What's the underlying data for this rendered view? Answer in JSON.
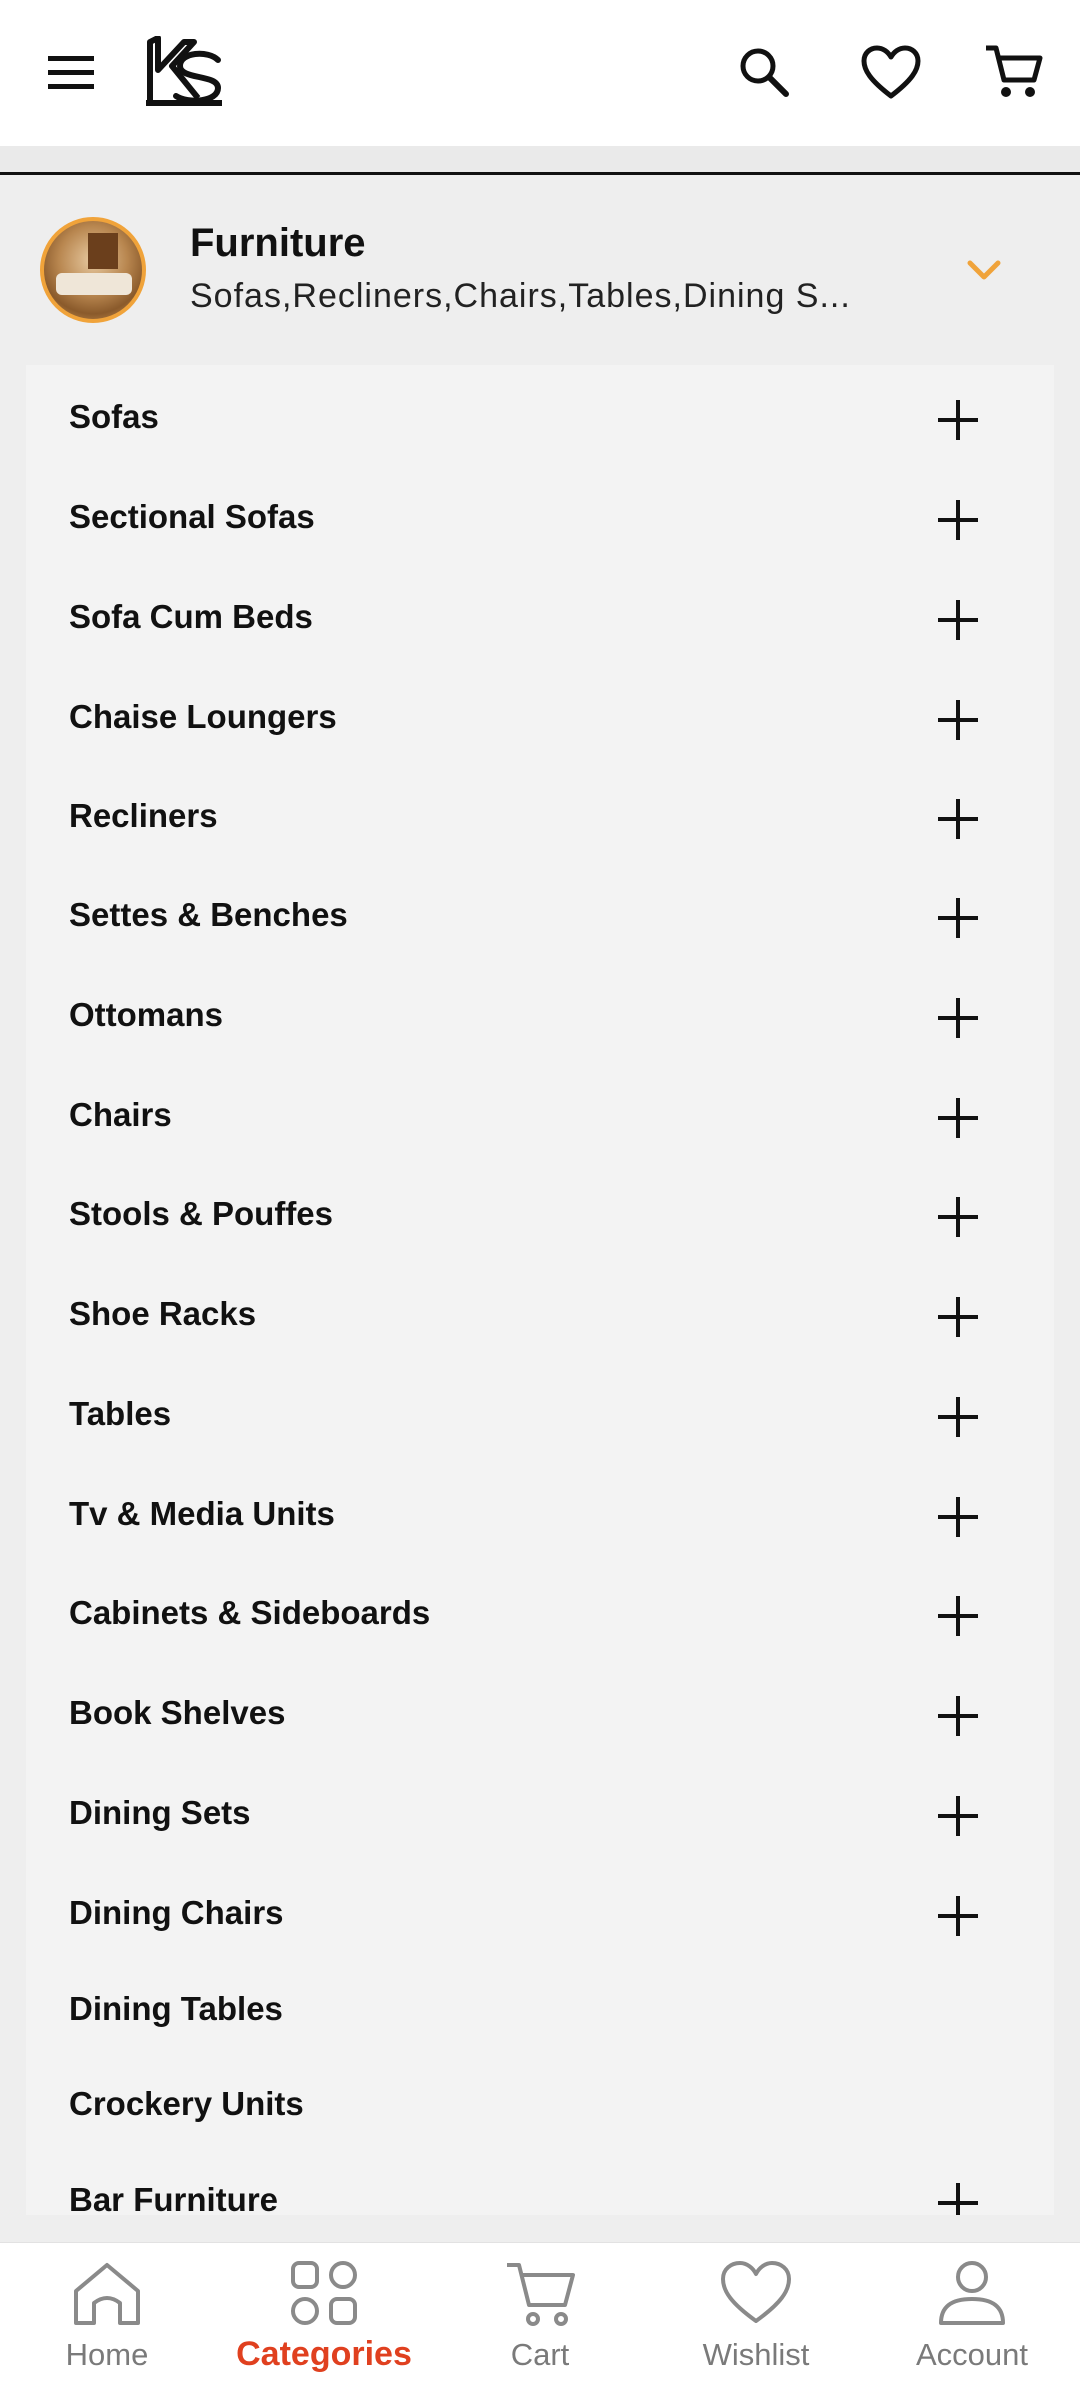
{
  "header": {
    "icons": [
      "menu-icon",
      "ks-logo",
      "search-icon",
      "heart-icon",
      "cart-icon"
    ]
  },
  "category": {
    "title": "Furniture",
    "subtitle": "Sofas,Recliners,Chairs,Tables,Dining S...",
    "accent_color": "#f0a33a"
  },
  "items": [
    {
      "label": "Sofas",
      "expandable": true
    },
    {
      "label": "Sectional Sofas",
      "expandable": true
    },
    {
      "label": "Sofa Cum Beds",
      "expandable": true
    },
    {
      "label": "Chaise Loungers",
      "expandable": true
    },
    {
      "label": "Recliners",
      "expandable": true
    },
    {
      "label": "Settes & Benches",
      "expandable": true
    },
    {
      "label": "Ottomans",
      "expandable": true
    },
    {
      "label": "Chairs",
      "expandable": true
    },
    {
      "label": "Stools & Pouffes",
      "expandable": true
    },
    {
      "label": "Shoe Racks",
      "expandable": true
    },
    {
      "label": "Tables",
      "expandable": true
    },
    {
      "label": "Tv & Media Units",
      "expandable": true
    },
    {
      "label": "Cabinets & Sideboards",
      "expandable": true
    },
    {
      "label": "Book Shelves",
      "expandable": true
    },
    {
      "label": "Dining Sets",
      "expandable": true
    },
    {
      "label": "Dining Chairs",
      "expandable": true
    },
    {
      "label": "Dining Tables",
      "expandable": false
    },
    {
      "label": "Crockery Units",
      "expandable": false
    },
    {
      "label": "Bar Furniture",
      "expandable": true
    }
  ],
  "bottom_nav": [
    {
      "label": "Home",
      "icon": "home-icon",
      "active": false
    },
    {
      "label": "Categories",
      "icon": "categories-icon",
      "active": true
    },
    {
      "label": "Cart",
      "icon": "cart-icon",
      "active": false
    },
    {
      "label": "Wishlist",
      "icon": "heart-icon",
      "active": false
    },
    {
      "label": "Account",
      "icon": "user-icon",
      "active": false
    }
  ],
  "colors": {
    "active_nav": "#e0401f",
    "inactive_nav": "#7a7a7a"
  }
}
